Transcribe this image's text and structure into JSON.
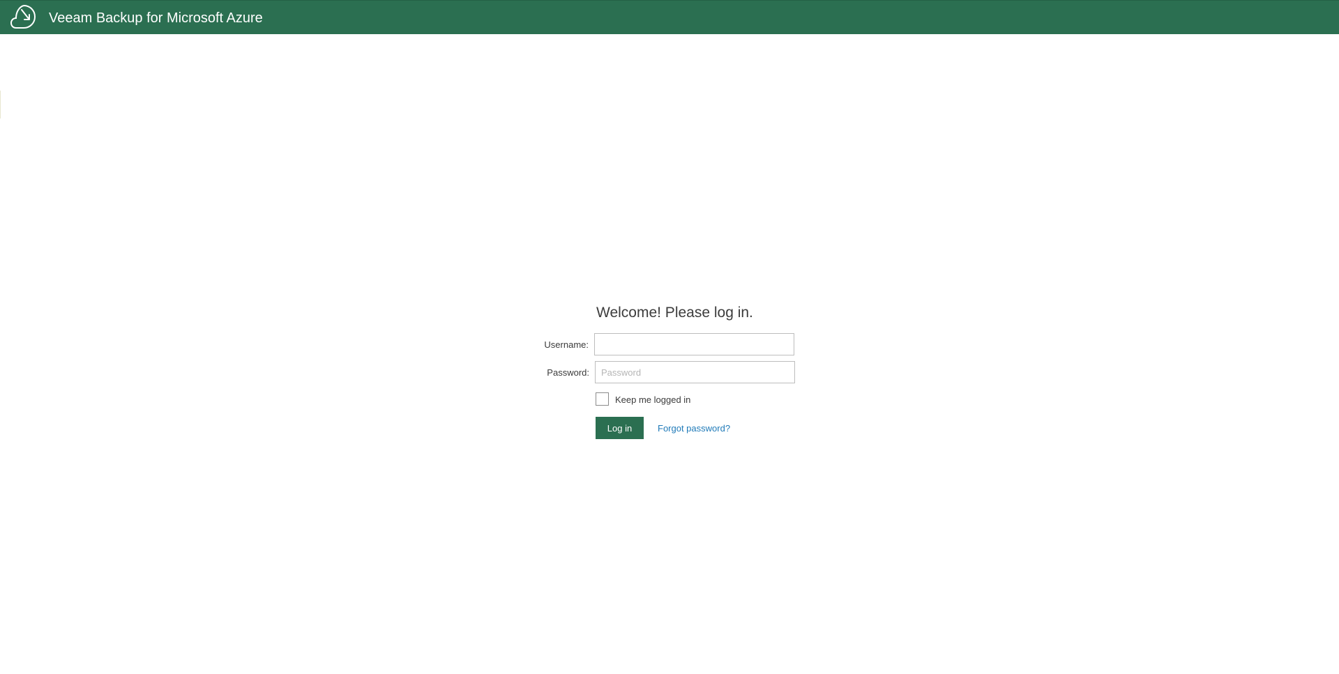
{
  "header": {
    "title": "Veeam Backup for Microsoft Azure",
    "logo_icon": "veeam-cloud-logo-icon",
    "background_color": "#2b6f51"
  },
  "login": {
    "welcome_text": "Welcome! Please log in.",
    "username_label": "Username:",
    "username_value": "",
    "password_label": "Password:",
    "password_placeholder": "Password",
    "keep_logged_in_label": "Keep me logged in",
    "keep_logged_in_checked": false,
    "login_button_label": "Log in",
    "forgot_password_label": "Forgot password?"
  },
  "colors": {
    "accent": "#2b6f51",
    "link": "#1f7ab8"
  }
}
